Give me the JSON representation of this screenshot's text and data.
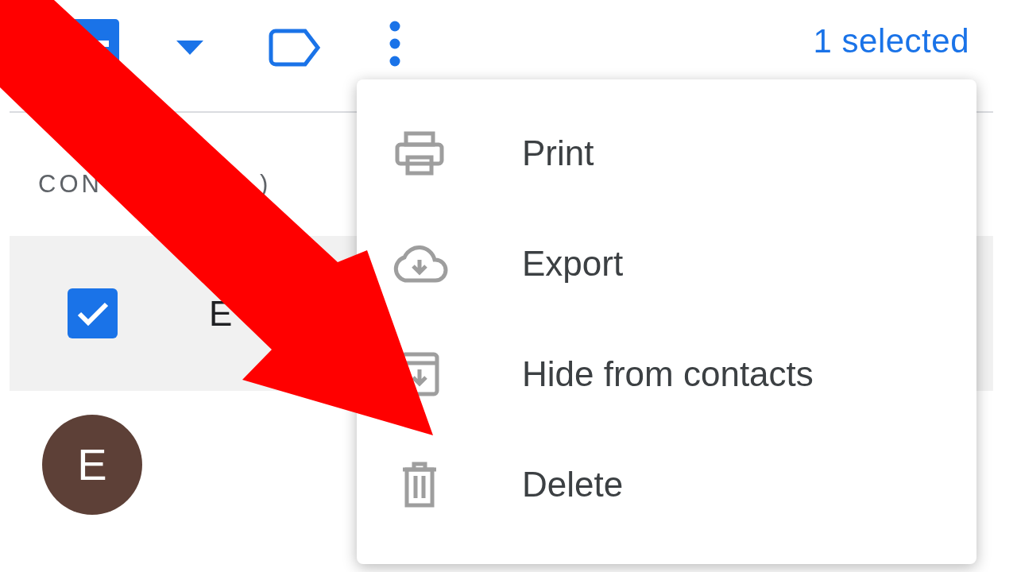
{
  "toolbar": {
    "select_all": {
      "indeterminate": true
    },
    "selection_count": "1 selected"
  },
  "section": {
    "label_parts": [
      "CON",
      ")"
    ]
  },
  "contacts": [
    {
      "kind": "checkbox",
      "name": "E",
      "checked": true,
      "selected": true
    },
    {
      "kind": "avatar",
      "initial": "E",
      "color": "#5d4037",
      "selected": false
    }
  ],
  "menu": {
    "items": [
      {
        "kind": "print",
        "label": "Print"
      },
      {
        "kind": "export",
        "label": "Export"
      },
      {
        "kind": "hide",
        "label": "Hide from contacts"
      },
      {
        "kind": "delete",
        "label": "Delete"
      }
    ]
  },
  "annotation": {
    "kind": "arrow"
  }
}
